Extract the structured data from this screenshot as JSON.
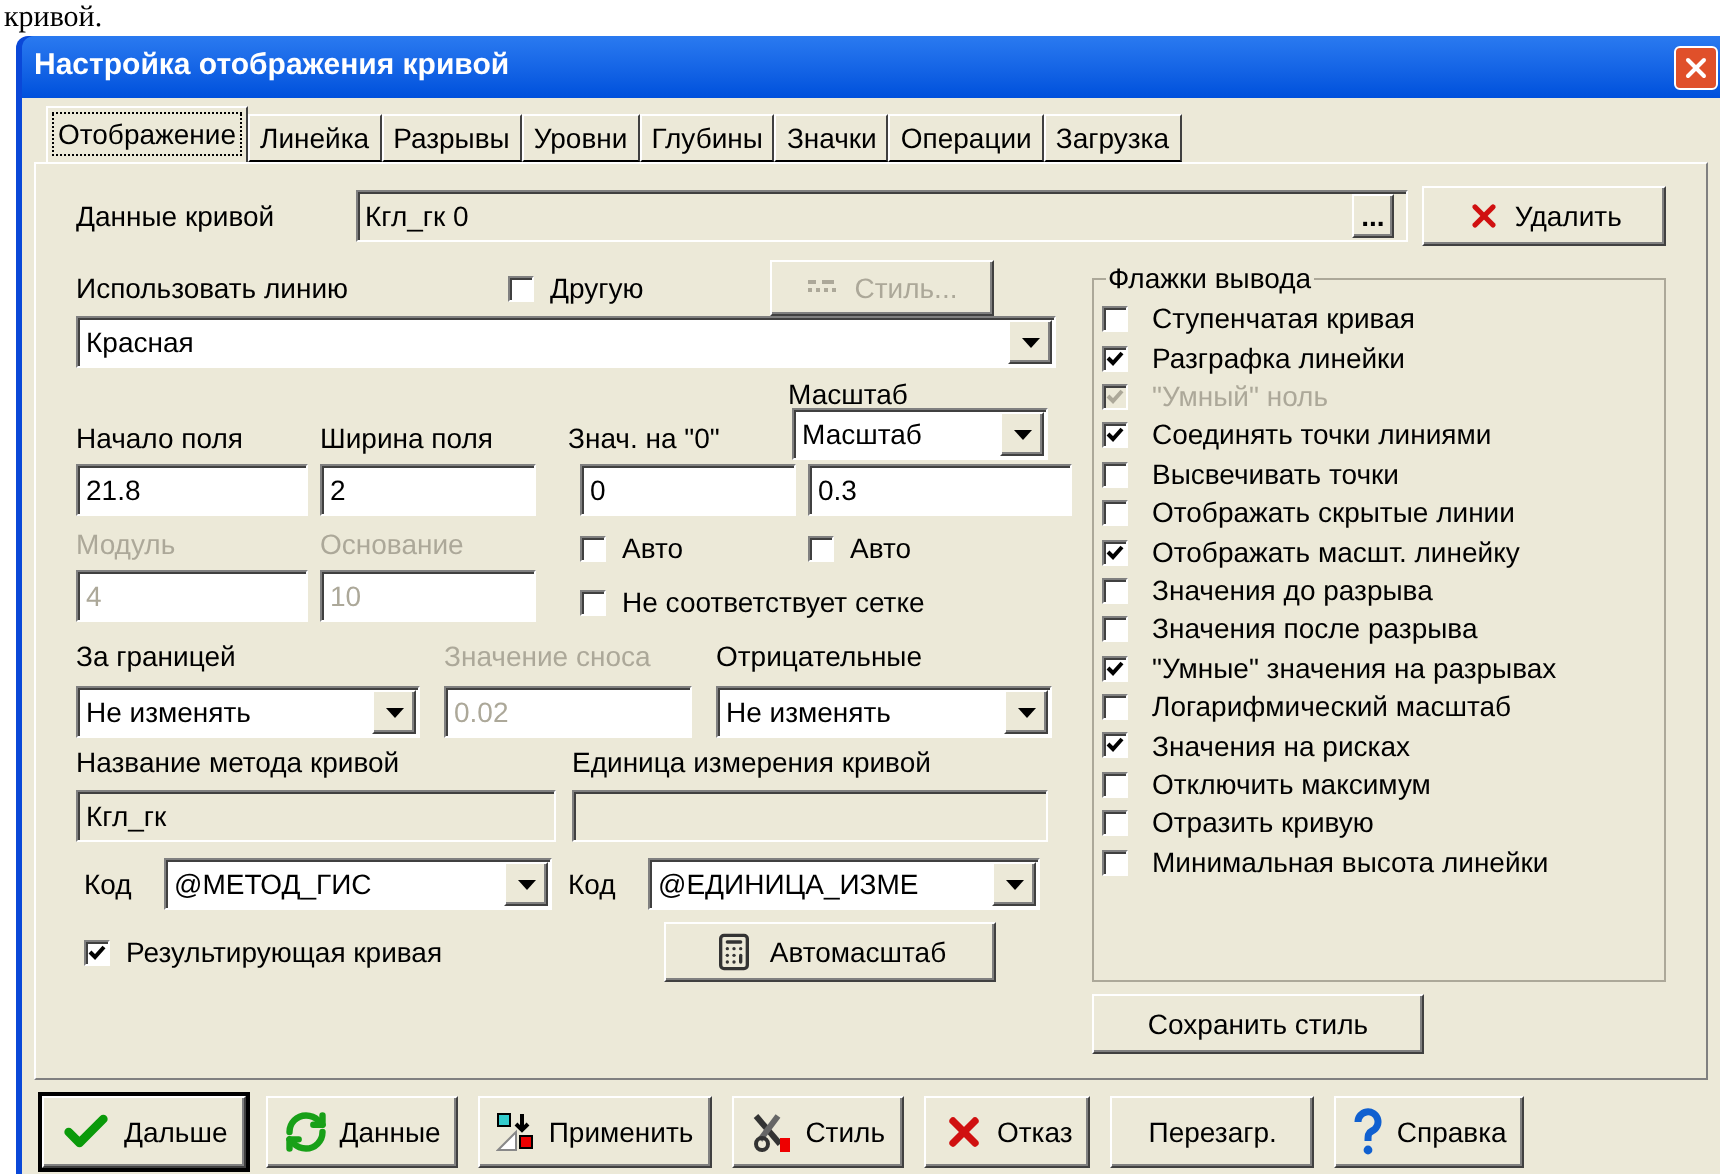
{
  "document_text": "кривой.",
  "window": {
    "title": "Настройка отображения кривой"
  },
  "tabs": [
    {
      "label": "Отображение",
      "selected": true
    },
    {
      "label": "Линейка",
      "selected": false
    },
    {
      "label": "Разрывы",
      "selected": false
    },
    {
      "label": "Уровни",
      "selected": false
    },
    {
      "label": "Глубины",
      "selected": false
    },
    {
      "label": "Значки",
      "selected": false
    },
    {
      "label": "Операции",
      "selected": false
    },
    {
      "label": "Загрузка",
      "selected": false
    }
  ],
  "curve_data": {
    "label": "Данные кривой",
    "value": "Кгл_гк 0",
    "browse": "...",
    "delete_button": "Удалить"
  },
  "use_line": {
    "label": "Использовать линию",
    "other": {
      "label": "Другую",
      "checked": false
    },
    "style_button": {
      "label": "Стиль...",
      "disabled": true
    },
    "value": "Красная"
  },
  "field_start": {
    "label": "Начало поля",
    "value": "21.8",
    "disabled": false
  },
  "field_width": {
    "label": "Ширина поля",
    "value": "2",
    "disabled": false
  },
  "zero_value": {
    "label": "Знач. на \"0\"",
    "value": "0",
    "disabled": false
  },
  "scale": {
    "label": "Масштаб",
    "select": "Масштаб",
    "value": "0.3",
    "disabled": false
  },
  "module": {
    "label": "Модуль",
    "value": "4",
    "disabled": true
  },
  "base": {
    "label": "Основание",
    "value": "10",
    "disabled": true
  },
  "zero_auto": {
    "label": "Авто",
    "checked": false
  },
  "scale_auto": {
    "label": "Авто",
    "checked": false
  },
  "grid_mismatch": {
    "label": "Не соответствует сетке",
    "checked": false
  },
  "beyond": {
    "label": "За границей",
    "value": "Не изменять"
  },
  "drift": {
    "label": "Значение сноса",
    "value": "0.02",
    "disabled": true
  },
  "negative": {
    "label": "Отрицательные",
    "value": "Не изменять"
  },
  "method_name": {
    "label": "Название метода кривой",
    "value": "Кгл_гк"
  },
  "unit_name": {
    "label": "Единица измерения кривой"
  },
  "method_code": {
    "label": "Код",
    "value": "@МЕТОД_ГИС"
  },
  "unit_code": {
    "label": "Код",
    "value": "@ЕДИНИЦА_ИЗМЕ"
  },
  "result_curve": {
    "label": "Результирующая кривая",
    "checked": true
  },
  "autoscale_button": "Автомасштаб",
  "flags": {
    "title": "Флажки вывода",
    "items": [
      {
        "label": "Ступенчатая кривая",
        "checked": false,
        "disabled": false
      },
      {
        "label": "Разграфка линейки",
        "checked": true,
        "disabled": false
      },
      {
        "label": "\"Умный\" ноль",
        "checked": true,
        "disabled": true
      },
      {
        "label": "Соединять точки линиями",
        "checked": true,
        "disabled": false
      },
      {
        "label": "Высвечивать точки",
        "checked": false,
        "disabled": false
      },
      {
        "label": "Отображать скрытые линии",
        "checked": false,
        "disabled": false
      },
      {
        "label": "Отображать масшт. линейку",
        "checked": true,
        "disabled": false
      },
      {
        "label": "Значения до разрыва",
        "checked": false,
        "disabled": false
      },
      {
        "label": "Значения после разрыва",
        "checked": false,
        "disabled": false
      },
      {
        "label": "\"Умные\" значения на разрывах",
        "checked": true,
        "disabled": false
      },
      {
        "label": "Логарифмический масштаб",
        "checked": false,
        "disabled": false
      },
      {
        "label": "Значения на рисках",
        "checked": true,
        "disabled": false
      },
      {
        "label": "Отключить максимум",
        "checked": false,
        "disabled": false
      },
      {
        "label": "Отразить кривую",
        "checked": false,
        "disabled": false
      },
      {
        "label": "Минимальная высота линейки",
        "checked": false,
        "disabled": false
      }
    ]
  },
  "save_style_button": "Сохранить стиль",
  "buttons": [
    {
      "label": "Дальше",
      "kind": "next",
      "default": true
    },
    {
      "label": "Данные",
      "kind": "data",
      "default": false
    },
    {
      "label": "Применить",
      "kind": "apply",
      "default": false
    },
    {
      "label": "Стиль",
      "kind": "style",
      "default": false
    },
    {
      "label": "Отказ",
      "kind": "cancel",
      "default": false
    },
    {
      "label": "Перезагр.",
      "kind": "plain",
      "default": false
    },
    {
      "label": "Справка",
      "kind": "help",
      "default": false
    }
  ]
}
